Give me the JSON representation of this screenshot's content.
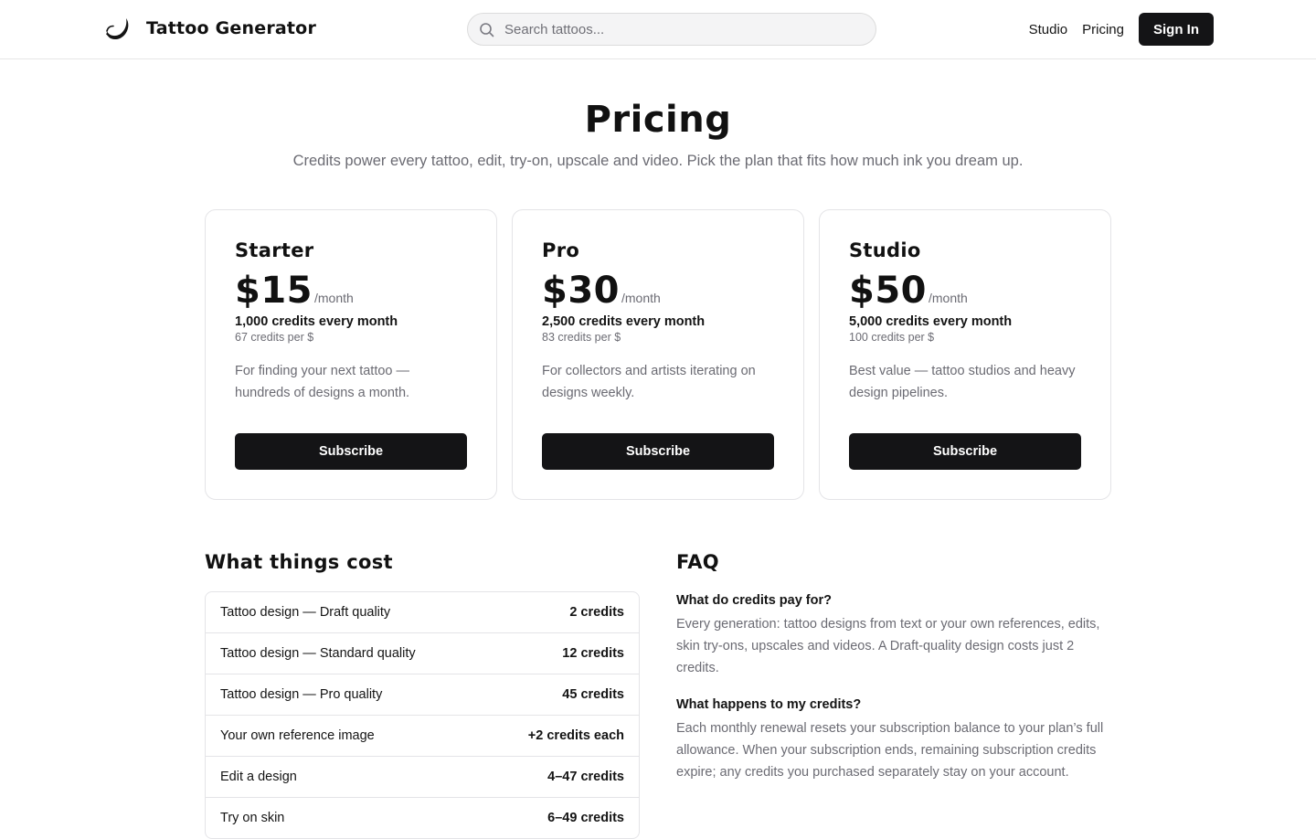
{
  "header": {
    "brand_name": "Tattoo Generator",
    "brand_icon": "crescent-swirl-logo",
    "search_placeholder": "Search tattoos...",
    "nav": [
      "Studio",
      "Pricing"
    ],
    "signin_label": "Sign In"
  },
  "hero": {
    "title": "Pricing",
    "subtitle": "Credits power every tattoo, edit, try-on, upscale and video. Pick the plan that fits how much ink you dream up."
  },
  "plans": [
    {
      "name": "Starter",
      "price": "$15",
      "period": "/month",
      "credits": "1,000 credits every month",
      "rate": "67 credits per $",
      "description": "For finding your next tattoo — hundreds of designs a month.",
      "button": "Subscribe"
    },
    {
      "name": "Pro",
      "price": "$30",
      "period": "/month",
      "credits": "2,500 credits every month",
      "rate": "83 credits per $",
      "description": "For collectors and artists iterating on designs weekly.",
      "button": "Subscribe"
    },
    {
      "name": "Studio",
      "price": "$50",
      "period": "/month",
      "credits": "5,000 credits every month",
      "rate": "100 credits per $",
      "description": "Best value — tattoo studios and heavy design pipelines.",
      "button": "Subscribe"
    }
  ],
  "costs": {
    "title": "What things cost",
    "rows": [
      {
        "label": "Tattoo design — Draft quality",
        "value": "2 credits"
      },
      {
        "label": "Tattoo design — Standard quality",
        "value": "12 credits"
      },
      {
        "label": "Tattoo design — Pro quality",
        "value": "45 credits"
      },
      {
        "label": "Your own reference image",
        "value": "+2 credits each"
      },
      {
        "label": "Edit a design",
        "value": "4–47 credits"
      },
      {
        "label": "Try on skin",
        "value": "6–49 credits"
      }
    ]
  },
  "faq": {
    "title": "FAQ",
    "items": [
      {
        "q": "What do credits pay for?",
        "a": "Every generation: tattoo designs from text or your own references, edits, skin try-ons, upscales and videos. A Draft-quality design costs just 2 credits."
      },
      {
        "q": "What happens to my credits?",
        "a": "Each monthly renewal resets your subscription balance to your plan’s full allowance. When your subscription ends, remaining subscription credits expire; any credits you purchased separately stay on your account."
      }
    ]
  }
}
